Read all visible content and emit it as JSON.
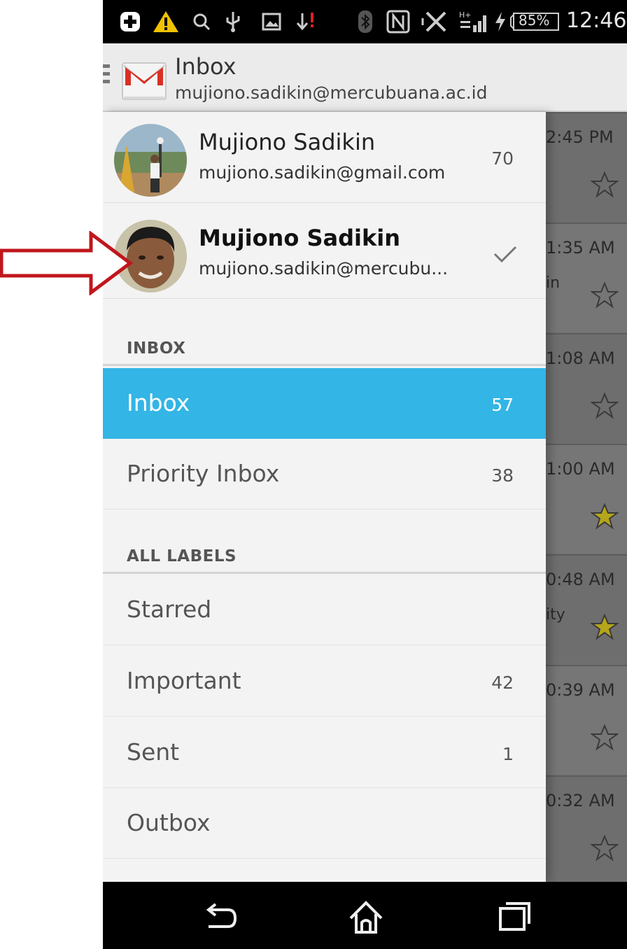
{
  "status_bar": {
    "battery": "85%",
    "time": "12:46",
    "icons": [
      "plus-icon",
      "warning-icon",
      "search-icon",
      "usb-icon",
      "image-icon",
      "download-alert-icon",
      "bluetooth-icon",
      "nfc-icon",
      "vibrate-icon",
      "signal-icon",
      "charging-icon"
    ],
    "network": "H+"
  },
  "action_bar": {
    "title": "Inbox",
    "subtitle": "mujiono.sadikin@mercubuana.ac.id"
  },
  "accounts": [
    {
      "name": "Mujiono Sadikin",
      "email": "mujiono.sadikin@gmail.com",
      "count": "70",
      "selected": false
    },
    {
      "name": "Mujiono Sadikin",
      "email": "mujiono.sadikin@mercubu...",
      "count": "",
      "selected": true
    }
  ],
  "sections": {
    "inbox": "INBOX",
    "all_labels": "ALL LABELS"
  },
  "inbox_items": [
    {
      "label": "Inbox",
      "count": "57",
      "selected": true
    },
    {
      "label": "Priority Inbox",
      "count": "38",
      "selected": false
    }
  ],
  "label_items": [
    {
      "label": "Starred",
      "count": ""
    },
    {
      "label": "Important",
      "count": "42"
    },
    {
      "label": "Sent",
      "count": "1"
    },
    {
      "label": "Outbox",
      "count": ""
    }
  ],
  "background_list": [
    {
      "time": "2:45 PM",
      "fragment": "",
      "starred": false
    },
    {
      "time": "1:35 AM",
      "fragment": "in",
      "starred": false
    },
    {
      "time": "1:08 AM",
      "fragment": "",
      "starred": false
    },
    {
      "time": "1:00 AM",
      "fragment": "",
      "starred": true
    },
    {
      "time": "0:48 AM",
      "fragment": "ity",
      "starred": true
    },
    {
      "time": "0:39 AM",
      "fragment": "",
      "starred": false
    },
    {
      "time": "0:32 AM",
      "fragment": "",
      "starred": false
    }
  ],
  "colors": {
    "selected_bg": "#33b5e5",
    "gmail_red": "#d93025",
    "arrow_red": "#c0161c",
    "star_yellow": "#d4c31a"
  }
}
